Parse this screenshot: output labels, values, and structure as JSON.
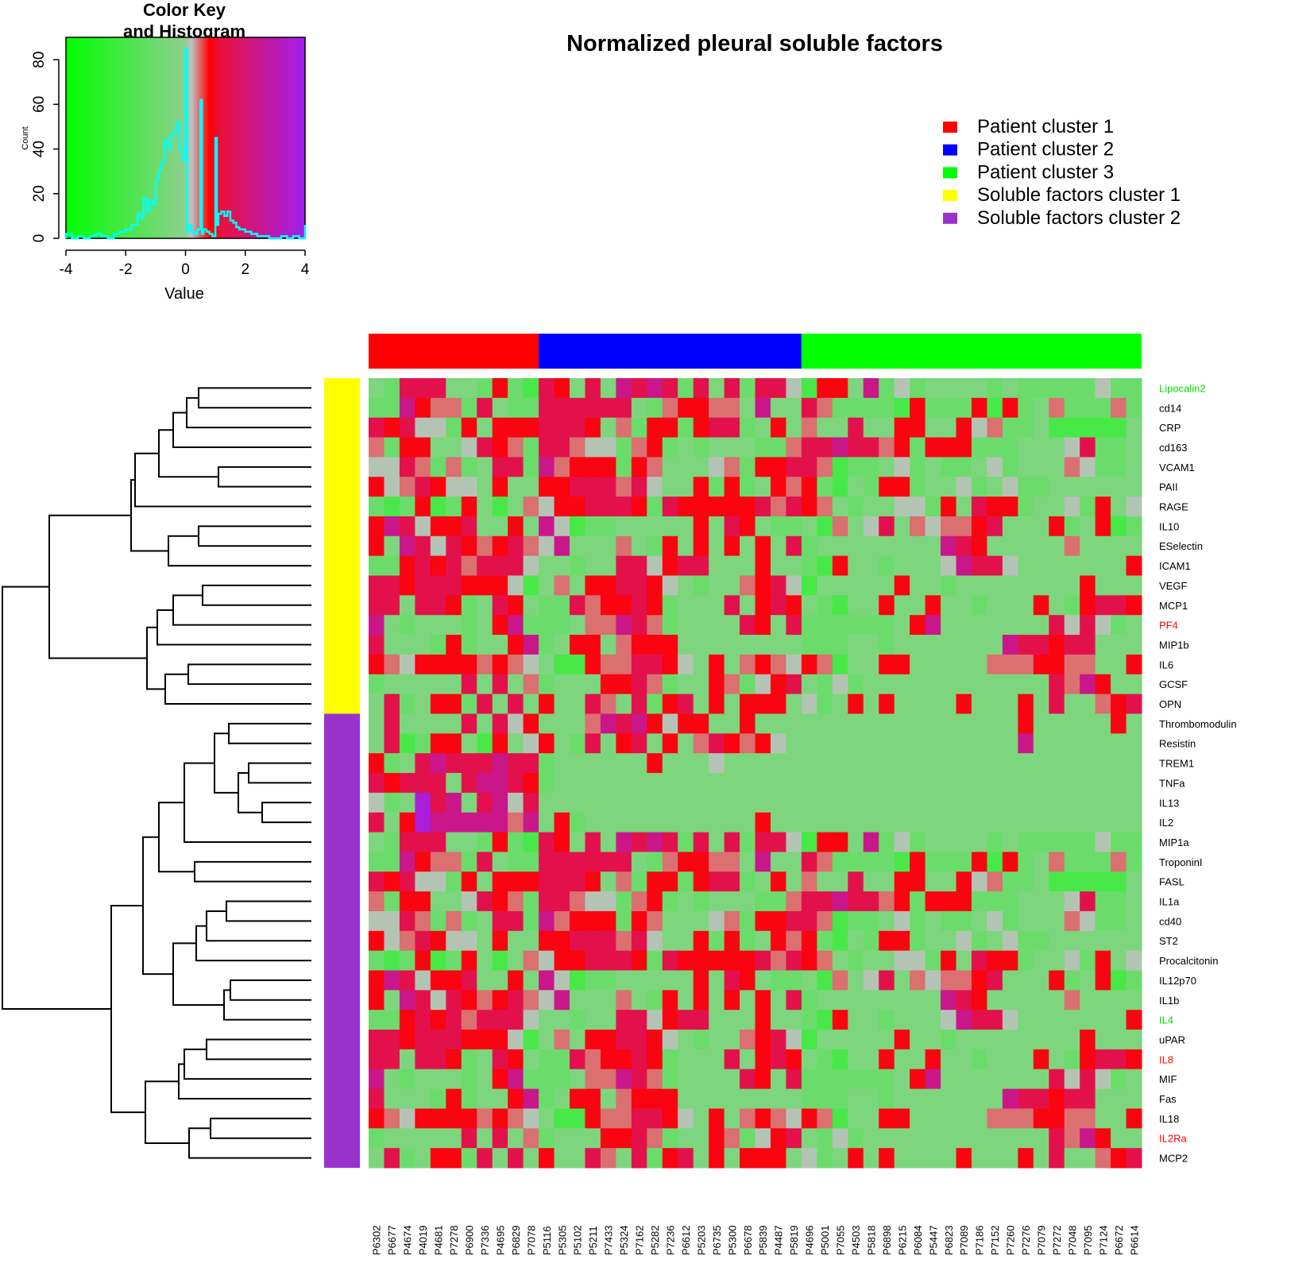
{
  "chart_data": {
    "type": "heatmap",
    "title": "Normalized pleural soluble factors",
    "color_key": {
      "title_line1": "Color Key",
      "title_line2": "and Histogram",
      "xlabel": "Value",
      "ylabel": "Count",
      "x_ticks": [
        "-4",
        "-2",
        "0",
        "2",
        "4"
      ],
      "y_ticks": [
        "0",
        "20",
        "40",
        "60",
        "80"
      ],
      "xlim": [
        -4,
        4
      ],
      "ylim": [
        0,
        90
      ],
      "gradient_stops": [
        {
          "value": -4,
          "color": "#00ff00"
        },
        {
          "value": 0,
          "color": "#8fd08f"
        },
        {
          "value": 0.2,
          "color": "#c0c0c0"
        },
        {
          "value": 0.8,
          "color": "#ff0000"
        },
        {
          "value": 1.2,
          "color": "#e8103e"
        },
        {
          "value": 4,
          "color": "#a020f0"
        }
      ],
      "histogram_color": "#00ffff",
      "histogram": {
        "x": [
          -4,
          -3.8,
          -3.6,
          -3.4,
          -3.2,
          -3,
          -2.8,
          -2.6,
          -2.4,
          -2.2,
          -2,
          -1.8,
          -1.6,
          -1.5,
          -1.4,
          -1.3,
          -1.2,
          -1.1,
          -1,
          -0.9,
          -0.8,
          -0.7,
          -0.6,
          -0.5,
          -0.4,
          -0.3,
          -0.2,
          -0.1,
          0,
          0.05,
          0.1,
          0.2,
          0.3,
          0.4,
          0.5,
          0.55,
          0.6,
          0.7,
          0.8,
          0.9,
          1,
          1.05,
          1.1,
          1.2,
          1.3,
          1.4,
          1.5,
          1.6,
          1.7,
          1.8,
          2,
          2.2,
          2.4,
          2.6,
          2.8,
          3,
          3.2,
          3.4,
          3.6,
          3.8,
          4
        ],
        "counts": [
          2,
          0,
          1,
          0,
          1,
          2,
          1,
          0,
          2,
          3,
          4,
          6,
          11,
          9,
          18,
          12,
          17,
          15,
          26,
          30,
          34,
          44,
          40,
          46,
          48,
          52,
          40,
          35,
          85,
          3,
          6,
          3,
          2,
          4,
          62,
          2,
          4,
          3,
          2,
          1,
          45,
          6,
          11,
          12,
          10,
          12,
          8,
          7,
          5,
          4,
          3,
          2,
          1,
          1,
          0,
          0,
          1,
          0,
          1,
          0,
          6
        ]
      }
    },
    "legend": {
      "position": "top-right",
      "entries": [
        {
          "label": "Patient cluster 1",
          "color": "#ff0000"
        },
        {
          "label": "Patient cluster 2",
          "color": "#0000ff"
        },
        {
          "label": "Patient cluster 3",
          "color": "#00ff00"
        },
        {
          "label": "Soluble factors cluster 1",
          "color": "#ffff00"
        },
        {
          "label": "Soluble factors cluster 2",
          "color": "#9932cc"
        }
      ]
    },
    "columns": [
      "P6302",
      "P6677",
      "P4674",
      "P4019",
      "P4681",
      "P7278",
      "P6900",
      "P7336",
      "P4695",
      "P6829",
      "P7078",
      "P5116",
      "P5305",
      "P5102",
      "P5211",
      "P7433",
      "P5324",
      "P7162",
      "P5282",
      "P7236",
      "P6612",
      "P5203",
      "P6735",
      "P5300",
      "P6678",
      "P5839",
      "P4487",
      "P5819",
      "P4696",
      "P5001",
      "P7055",
      "P4503",
      "P5818",
      "P6898",
      "P6215",
      "P6084",
      "P5447",
      "P6823",
      "P7089",
      "P7186",
      "P7152",
      "P7260",
      "P7276",
      "P7079",
      "P7272",
      "P7048",
      "P7095",
      "P7124",
      "P6672",
      "P6614"
    ],
    "column_clusters": [
      {
        "name": "Patient cluster 1",
        "count": 11,
        "color": "#ff0000"
      },
      {
        "name": "Patient cluster 2",
        "count": 17,
        "color": "#0000ff"
      },
      {
        "name": "Patient cluster 3",
        "count": 22,
        "color": "#00ff00"
      }
    ],
    "rows": [
      {
        "label": "Lipocalin2",
        "color": "#00dd00"
      },
      {
        "label": "cd14",
        "color": "#000000"
      },
      {
        "label": "CRP",
        "color": "#000000"
      },
      {
        "label": "cd163",
        "color": "#000000"
      },
      {
        "label": "VCAM1",
        "color": "#000000"
      },
      {
        "label": "PAII",
        "color": "#000000"
      },
      {
        "label": "RAGE",
        "color": "#000000"
      },
      {
        "label": "IL10",
        "color": "#000000"
      },
      {
        "label": "ESelectin",
        "color": "#000000"
      },
      {
        "label": "ICAM1",
        "color": "#000000"
      },
      {
        "label": "VEGF",
        "color": "#000000"
      },
      {
        "label": "MCP1",
        "color": "#000000"
      },
      {
        "label": "PF4",
        "color": "#ff0000"
      },
      {
        "label": "MIP1b",
        "color": "#000000"
      },
      {
        "label": "IL6",
        "color": "#000000"
      },
      {
        "label": "GCSF",
        "color": "#000000"
      },
      {
        "label": "OPN",
        "color": "#000000"
      },
      {
        "label": "Thrombomodulin",
        "color": "#000000"
      },
      {
        "label": "Resistin",
        "color": "#000000"
      },
      {
        "label": "TREM1",
        "color": "#000000"
      },
      {
        "label": "TNFa",
        "color": "#000000"
      },
      {
        "label": "IL13",
        "color": "#000000"
      },
      {
        "label": "IL2",
        "color": "#000000"
      },
      {
        "label": "MIP1a",
        "color": "#000000"
      },
      {
        "label": "TroponinI",
        "color": "#000000"
      },
      {
        "label": "FASL",
        "color": "#000000"
      },
      {
        "label": "IL1a",
        "color": "#000000"
      },
      {
        "label": "cd40",
        "color": "#000000"
      },
      {
        "label": "ST2",
        "color": "#000000"
      },
      {
        "label": "Procalcitonin",
        "color": "#000000"
      },
      {
        "label": "IL12p70",
        "color": "#000000"
      },
      {
        "label": "IL1b",
        "color": "#000000"
      },
      {
        "label": "IL4",
        "color": "#00dd00"
      },
      {
        "label": "uPAR",
        "color": "#000000"
      },
      {
        "label": "IL8",
        "color": "#ff0000"
      },
      {
        "label": "MIF",
        "color": "#000000"
      },
      {
        "label": "Fas",
        "color": "#000000"
      },
      {
        "label": "IL18",
        "color": "#000000"
      },
      {
        "label": "IL2Ra",
        "color": "#ff0000"
      },
      {
        "label": "MCP2",
        "color": "#000000"
      }
    ],
    "row_clusters": [
      {
        "name": "Soluble factors cluster 1",
        "count": 17,
        "color": "#ffff00"
      },
      {
        "name": "Soluble factors cluster 2",
        "count": 23,
        "color": "#9932cc"
      }
    ],
    "value_codes": {
      "G": -2.0,
      "g": -1.0,
      "l": -0.5,
      "w": 0.15,
      "p": 0.45,
      "r": 0.9,
      "R": 1.4,
      "m": 2.4,
      "v": 3.6
    },
    "matrix_codes": [
      "lgRRRllgrgGRrlRlmRmRgRlRgRRwGrrlmgwgllllglgggggwgg",
      "ggmrppgRlggRRRRRRlgprrpplmllRpggggGrgggrGrglpgggpgl",
      "RrRwwgrlrrrRRRrlpgrrgrRRglrlpllRllrrllrwpgglGGGGGlr",
      "pgrrllwRrpgRRpwwgprglglllggpRRmRRprgrrrggglllwRgg",
      "wwRpgpglRRgmprrrgrplllwpgrrRRpGgglwglgglwglllpwgglp",
      "rwpRrwwlrllrrRRRpRwllrgrglrprgGlgrrgllwglwgglllll",
      "gGgrGgrlGlpwrrRRRrgRrrrrrRpRrplgllwwgrlRrrgllwgrlw",
      "rmRwrrRllrlmwGgglllllrlRrlgglGplwRlpwpprRlllrglrGgl",
      "rlmRwRrprRpwmlllplgrlrlrlrlRgllllllllmRrlllllplll",
      "ggrRrRpRRRwllgllRRwrRRlllrllgGrllglllwmRRwlllllllr",
      "RRrRRRrrrwGlplrrRRrwlgllprRwGlllllrllgllllllllrlllr",
      "RRlRRrglRrlggRprrRrglllRlrRrlgGllrllrllglllrlgrRRrR",
      "mlglllglrmggglppmRpgllllRrlRgggggglrmlllllllRwRwgll",
      "RlllgrgllrmglrrlprrrllllllllgggllglllllllmRRrRRll",
      "rpwrrrrprpwlGGrppRRrwlrlprpwrpGllrrlllllppprrppllrr",
      "glllllRlRlpglllrrRpgllrpgwrRlgwgllllllllllllRpmrl",
      "lRglrrgRlRlrllRplRgrRlrlrrrlwglrlrllllrlllrlRllprR",
      "lRllllRlRwrlllpmRmrwrrllrlllllllllllllllllrlllllrl",
      "lRGgrrlGrlwrlgRlrRlrlpRrprwlllllllllllllllmllllll",
      "rglRmRRRmRRgllllllrlllwlllllllllllllllllllllllllll",
      "RrRRRlRmmRrglllllllllllllllllllllllllllllllllll",
      "wglvRmlRmwRllllllllllllllllllllllllllllllllllllll",
      "Rlrvmmmmmpmlrglllllllllllrlllllllllllllllllllllll"
    ]
  }
}
